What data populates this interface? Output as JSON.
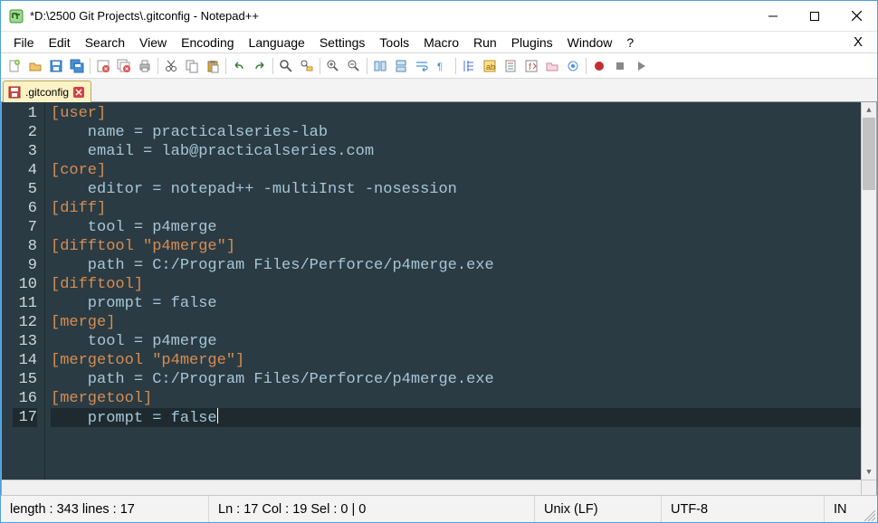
{
  "window": {
    "title": "*D:\\2500 Git Projects\\.gitconfig - Notepad++"
  },
  "menu": {
    "items": [
      "File",
      "Edit",
      "Search",
      "View",
      "Encoding",
      "Language",
      "Settings",
      "Tools",
      "Macro",
      "Run",
      "Plugins",
      "Window",
      "?"
    ],
    "close_x": "X"
  },
  "tab": {
    "filename": ".gitconfig"
  },
  "code": {
    "lines": [
      {
        "n": 1,
        "text": "[user]",
        "cls": "section"
      },
      {
        "n": 2,
        "text": "    name = practicalseries-lab",
        "cls": "kv"
      },
      {
        "n": 3,
        "text": "    email = lab@practicalseries.com",
        "cls": "kv"
      },
      {
        "n": 4,
        "text": "[core]",
        "cls": "section"
      },
      {
        "n": 5,
        "text": "    editor = notepad++ -multiInst -nosession",
        "cls": "kv"
      },
      {
        "n": 6,
        "text": "[diff]",
        "cls": "section"
      },
      {
        "n": 7,
        "text": "    tool = p4merge",
        "cls": "kv"
      },
      {
        "n": 8,
        "text": "[difftool \"p4merge\"]",
        "cls": "section"
      },
      {
        "n": 9,
        "text": "    path = C:/Program Files/Perforce/p4merge.exe",
        "cls": "kv"
      },
      {
        "n": 10,
        "text": "[difftool]",
        "cls": "section"
      },
      {
        "n": 11,
        "text": "    prompt = false",
        "cls": "kv"
      },
      {
        "n": 12,
        "text": "[merge]",
        "cls": "section"
      },
      {
        "n": 13,
        "text": "    tool = p4merge",
        "cls": "kv"
      },
      {
        "n": 14,
        "text": "[mergetool \"p4merge\"]",
        "cls": "section"
      },
      {
        "n": 15,
        "text": "    path = C:/Program Files/Perforce/p4merge.exe",
        "cls": "kv"
      },
      {
        "n": 16,
        "text": "[mergetool]",
        "cls": "section"
      },
      {
        "n": 17,
        "text": "    prompt = false",
        "cls": "kv",
        "current": true
      }
    ]
  },
  "status": {
    "length": "length : 343    lines : 17",
    "pos": "Ln : 17    Col : 19    Sel : 0 | 0",
    "eol": "Unix (LF)",
    "enc": "UTF-8",
    "mode": "IN"
  }
}
